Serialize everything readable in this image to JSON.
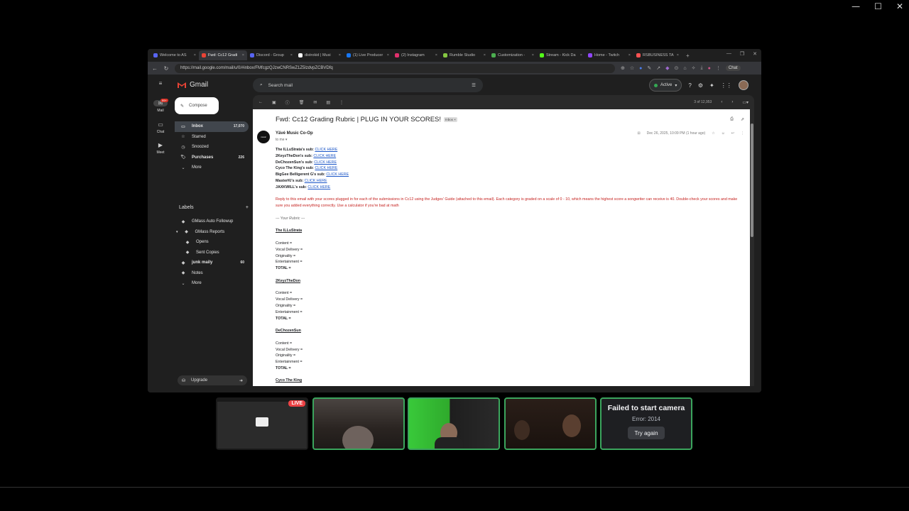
{
  "outer_window": {
    "minimize": "—",
    "maximize": "☐",
    "close": "✕"
  },
  "browser": {
    "tabs": [
      {
        "label": "Welcome to AS",
        "color": "#5865f2"
      },
      {
        "label": "Fwd: Cc12 Gradi",
        "color": "#ea4335",
        "active": true
      },
      {
        "label": "Discord - Group",
        "color": "#5865f2"
      },
      {
        "label": "distrokid | Musi",
        "color": "#ffffff"
      },
      {
        "label": "(1) Live Producer",
        "color": "#1877f2"
      },
      {
        "label": "(2) Instagram",
        "color": "#e1306c"
      },
      {
        "label": "Rumble Studio",
        "color": "#85c742"
      },
      {
        "label": "Customization -",
        "color": "#4caf50"
      },
      {
        "label": "Stream - Kick Da",
        "color": "#53fc18"
      },
      {
        "label": "Home - Twitch",
        "color": "#9146ff"
      },
      {
        "label": "RSBUSINESS TA",
        "color": "#ff5252"
      }
    ],
    "tab_close": "×",
    "new_tab": "+",
    "url": "https://mail.google.com/mail/u/0/#inbox/FMfcgzQJzwCNRSwZ1Z5lzdvpZCBVDfq",
    "chat_label": "Chat"
  },
  "gmail": {
    "rail": [
      {
        "icon": "✉",
        "label": "Mail"
      },
      {
        "icon": "▭",
        "label": "Chat"
      },
      {
        "icon": "▶",
        "label": "Meet"
      }
    ],
    "mail_badge": "99+",
    "logo_text": "Gmail",
    "compose_label": "Compose",
    "nav": [
      {
        "icon": "▭",
        "label": "Inbox",
        "count": "17,070",
        "active": true
      },
      {
        "icon": "☆",
        "label": "Starred",
        "count": ""
      },
      {
        "icon": "◷",
        "label": "Snoozed",
        "count": ""
      },
      {
        "icon": "🏷",
        "label": "Purchases",
        "count": "226",
        "bold": true
      },
      {
        "icon": "⌄",
        "label": "More",
        "count": ""
      }
    ],
    "labels_heading": "Labels",
    "labels_add": "+",
    "labels": [
      {
        "label": "GMass Auto Followup",
        "count": "",
        "sub": false
      },
      {
        "label": "GMass Reports",
        "count": "",
        "sub": false,
        "caret": "▾"
      },
      {
        "label": "Opens",
        "count": "",
        "sub": true
      },
      {
        "label": "Sent Copies",
        "count": "",
        "sub": true
      },
      {
        "label": "junk maily",
        "count": "60",
        "sub": false,
        "bold": true
      },
      {
        "label": "Notes",
        "count": "",
        "sub": false
      },
      {
        "label": "More",
        "count": "",
        "sub": false
      }
    ],
    "upgrade_label": "Upgrade",
    "search_placeholder": "Search mail",
    "status_label": "Active",
    "status_color": "#34a853",
    "pager": "3 of 12,953",
    "message": {
      "subject": "Fwd: Cc12 Grading Rubric | PLUG IN YOUR SCORES!",
      "chip": "Inbox ×",
      "sender": "Yävé Music Co-Op",
      "to": "to me ▾",
      "date": "Dec 26, 2025, 10:09 PM (1 hour ago)",
      "avatar_text": "music",
      "subs": [
        {
          "name": "The ILLuStrata's sub:",
          "link": "CLICK HERE"
        },
        {
          "name": "2KeyzTheDon's sub:",
          "link": "CLICK HERE"
        },
        {
          "name": "DeChozenSun's sub:",
          "link": "CLICK HERE"
        },
        {
          "name": "Cyco The King's sub:",
          "link": "CLICK HERE"
        },
        {
          "name": "BigGee Belligerent G's sub:",
          "link": "CLICK HERE"
        },
        {
          "name": "MasterKi's sub:",
          "link": "CLICK HERE"
        },
        {
          "name": "JAXKWILL's sub:",
          "link": "CLICK HERE"
        }
      ],
      "instructions": "Reply to this email with your scores plugged in for each of the submissions in Cc12 using the Judges' Guide (attached to this email). Each category is graded on a scale of 0 - 10, which means the highest score a songwriter can receive is 40. Double-check your scores and make sure you added everything correctly. Use a calculator if you're bad at math",
      "rubric_heading": "--- Your Rubric ---",
      "rubrics": [
        {
          "artist": "The ILLuStrata",
          "lines": [
            "Content =",
            "Vocal Delivery =",
            "Originality =",
            "Entertainment ="
          ],
          "total": "TOTAL ="
        },
        {
          "artist": "2KeyzTheDon",
          "lines": [
            "Content =",
            "Vocal Delivery =",
            "Originality =",
            "Entertainment ="
          ],
          "total": "TOTAL ="
        },
        {
          "artist": "DeChozenSun",
          "lines": [
            "Content =",
            "Vocal Delivery =",
            "Originality =",
            "Entertainment ="
          ],
          "total": "TOTAL ="
        },
        {
          "artist": "Cyco The King",
          "lines": [],
          "total": ""
        }
      ]
    }
  },
  "call": {
    "live_badge": "LIVE",
    "fail_title": "Failed to start camera",
    "fail_error": "Error: 2014",
    "try_again": "Try again"
  }
}
